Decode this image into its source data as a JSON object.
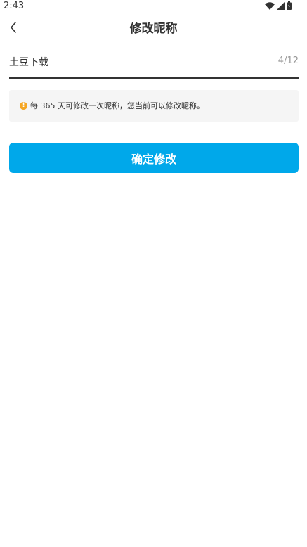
{
  "status_bar": {
    "time": "2:43",
    "icons": [
      "wifi-icon",
      "cellular-signal-icon",
      "battery-charging-icon"
    ]
  },
  "header": {
    "back_icon": "chevron-left-icon",
    "title": "修改昵称"
  },
  "nickname_field": {
    "value": "土豆下载",
    "counter": "4/12"
  },
  "notice": {
    "icon": "info-icon",
    "icon_color": "#f5a623",
    "icon_glyph": "!",
    "text": "每 365 天可修改一次昵称，您当前可以修改昵称。"
  },
  "confirm_button": {
    "label": "确定修改",
    "color": "#00a8ea"
  }
}
